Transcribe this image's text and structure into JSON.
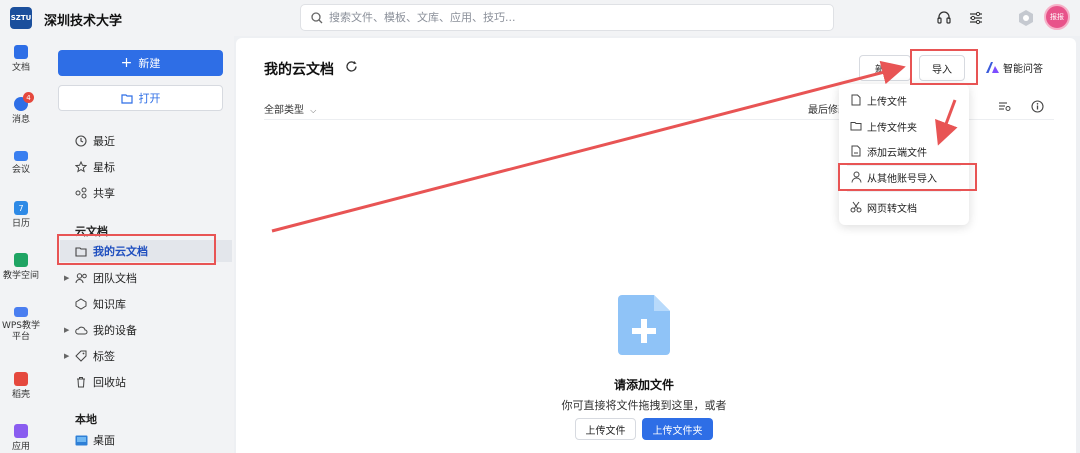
{
  "topbar": {
    "logo_text": "SZTU",
    "org_name": "深圳技术大学",
    "search_placeholder": "搜索文件、模板、文库、应用、技巧...",
    "avatar_text": "报报"
  },
  "rail": {
    "items": [
      {
        "label": "文档",
        "color": "#2e6ee6"
      },
      {
        "label": "消息",
        "color": "#2e6ee6",
        "badge": "4"
      },
      {
        "label": "会议",
        "color": "#3a7ff0"
      },
      {
        "label": "日历",
        "color": "#2e8ae6",
        "icon_text": "7"
      },
      {
        "label": "教学空间",
        "color": "#1fa463"
      },
      {
        "label": "WPS教学\n平台",
        "color": "#4a7ef0"
      },
      {
        "label": "稻壳",
        "color": "#e5483d"
      },
      {
        "label": "应用",
        "color": "#8a5cf0"
      }
    ]
  },
  "sidebar": {
    "new_label": "新建",
    "open_label": "打开",
    "quick": [
      "最近",
      "星标",
      "共享"
    ],
    "cloud_section": "云文档",
    "cloud_items": [
      "我的云文档",
      "团队文档",
      "知识库",
      "我的设备",
      "标签",
      "回收站"
    ],
    "local_section": "本地",
    "local_items": [
      "桌面"
    ]
  },
  "main": {
    "title": "我的云文档",
    "new_btn": "新建",
    "import_btn": "导入",
    "ai_btn": "智能问答",
    "filter": "全部类型",
    "sort": "最后修改",
    "empty_title": "请添加文件",
    "empty_desc": "你可直接将文件拖拽到这里，或者",
    "upload_file": "上传文件",
    "upload_folder": "上传文件夹"
  },
  "dropdown": {
    "items": [
      "上传文件",
      "上传文件夹",
      "添加云端文件",
      "从其他账号导入",
      "网页转文档"
    ]
  },
  "colors": {
    "accent": "#2e6ee6",
    "annotation": "#e85454"
  }
}
